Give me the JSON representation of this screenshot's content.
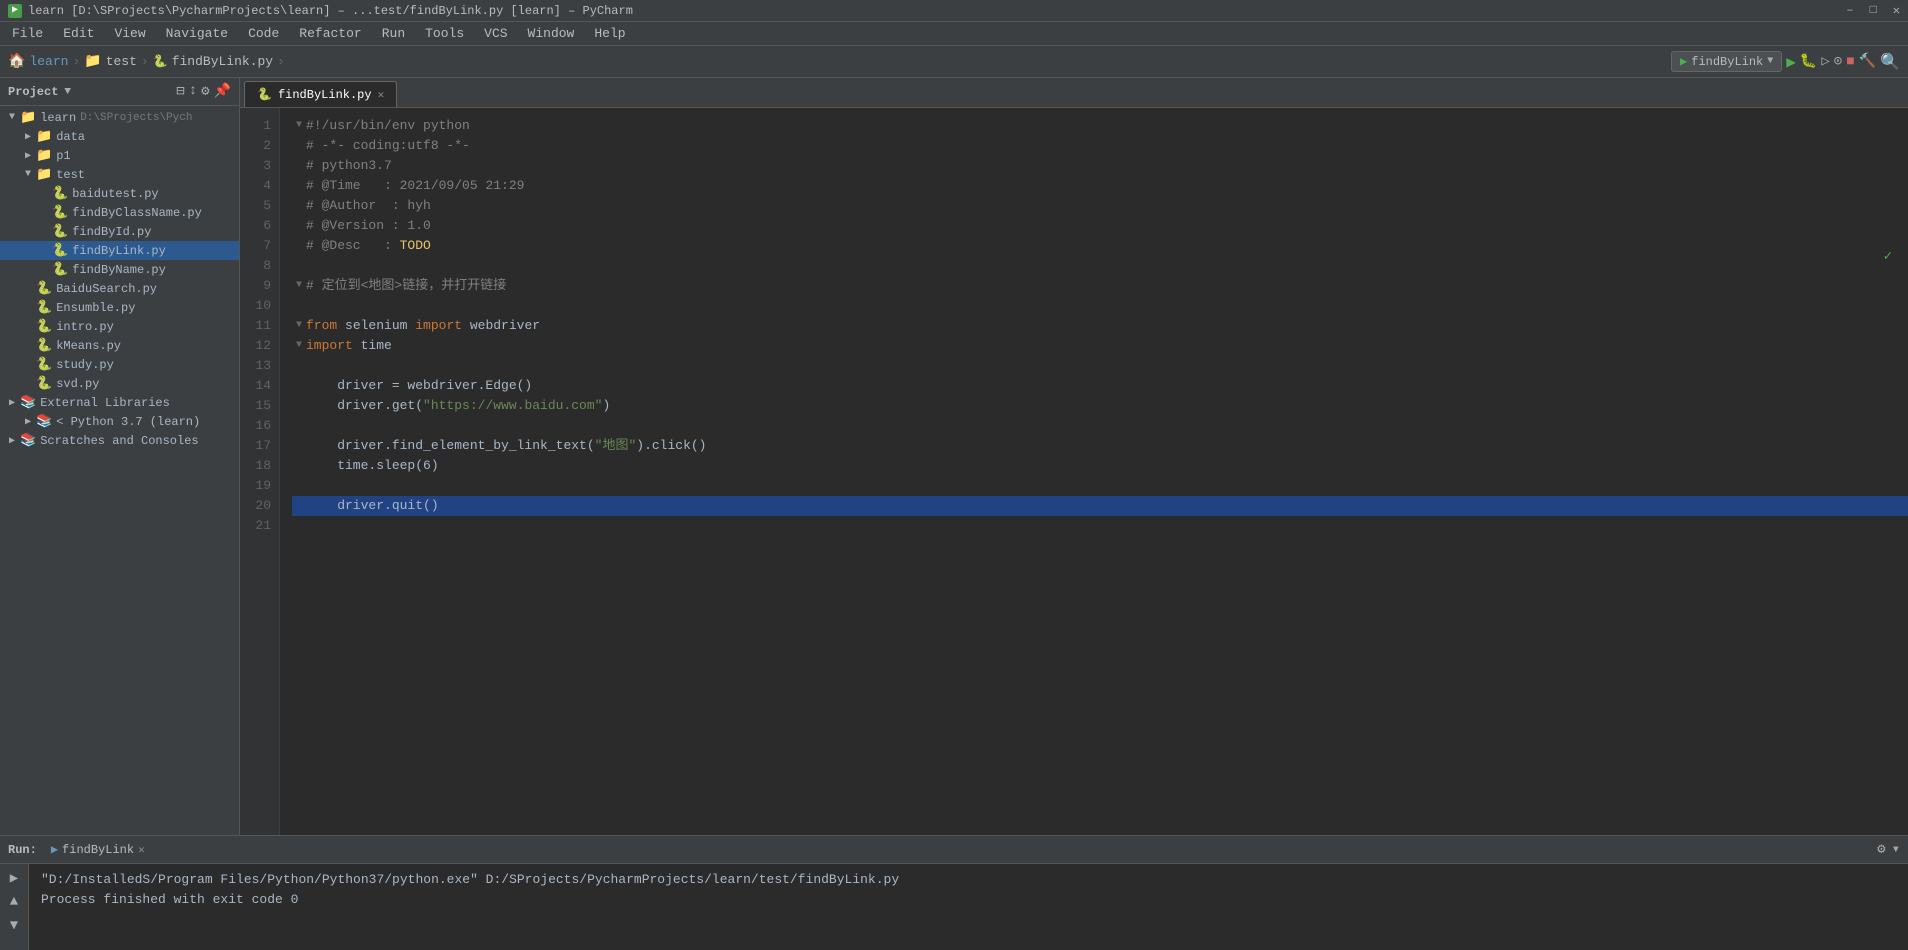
{
  "titleBar": {
    "text": "learn [D:\\SProjects\\PycharmProjects\\learn] – ...test/findByLink.py [learn] – PyCharm",
    "icon": "▶"
  },
  "menuBar": {
    "items": [
      "File",
      "Edit",
      "View",
      "Navigate",
      "Code",
      "Refactor",
      "Run",
      "Tools",
      "VCS",
      "Window",
      "Help"
    ]
  },
  "navBar": {
    "breadcrumbs": [
      "learn",
      "test",
      "findByLink.py"
    ],
    "runConfig": "findByLink"
  },
  "tabs": [
    {
      "label": "findByLink.py",
      "active": true,
      "modified": false
    }
  ],
  "sidebar": {
    "title": "Project",
    "tree": [
      {
        "level": 0,
        "type": "folder",
        "label": "learn",
        "path": "D:\\SProjects\\Pych",
        "open": true,
        "arrow": "▼"
      },
      {
        "level": 1,
        "type": "folder",
        "label": "data",
        "open": false,
        "arrow": "▶"
      },
      {
        "level": 1,
        "type": "folder",
        "label": "p1",
        "open": false,
        "arrow": "▶"
      },
      {
        "level": 1,
        "type": "folder",
        "label": "test",
        "open": true,
        "arrow": "▼"
      },
      {
        "level": 2,
        "type": "py",
        "label": "baidutest.py",
        "open": false,
        "arrow": ""
      },
      {
        "level": 2,
        "type": "py",
        "label": "findByClassName.py",
        "open": false,
        "arrow": ""
      },
      {
        "level": 2,
        "type": "py",
        "label": "findById.py",
        "open": false,
        "arrow": ""
      },
      {
        "level": 2,
        "type": "py",
        "label": "findByLink.py",
        "open": false,
        "arrow": "",
        "selected": true
      },
      {
        "level": 2,
        "type": "py",
        "label": "findByName.py",
        "open": false,
        "arrow": ""
      },
      {
        "level": 1,
        "type": "py",
        "label": "BaiduSearch.py",
        "open": false,
        "arrow": ""
      },
      {
        "level": 1,
        "type": "py",
        "label": "Ensumble.py",
        "open": false,
        "arrow": ""
      },
      {
        "level": 1,
        "type": "py",
        "label": "intro.py",
        "open": false,
        "arrow": ""
      },
      {
        "level": 1,
        "type": "py",
        "label": "kMeans.py",
        "open": false,
        "arrow": ""
      },
      {
        "level": 1,
        "type": "py",
        "label": "study.py",
        "open": false,
        "arrow": ""
      },
      {
        "level": 1,
        "type": "py",
        "label": "svd.py",
        "open": false,
        "arrow": ""
      },
      {
        "level": 0,
        "type": "extlib",
        "label": "External Libraries",
        "open": false,
        "arrow": "▶"
      },
      {
        "level": 1,
        "type": "extlib",
        "label": "< Python 3.7 (learn)",
        "open": false,
        "arrow": "▶"
      },
      {
        "level": 0,
        "type": "extlib",
        "label": "Scratches and Consoles",
        "open": false,
        "arrow": "▶"
      }
    ]
  },
  "editor": {
    "filename": "findByLink.py",
    "lines": [
      {
        "num": 1,
        "fold": "▼",
        "tokens": [
          {
            "cls": "c-shebang",
            "t": "#!/usr/bin/env python"
          }
        ]
      },
      {
        "num": 2,
        "fold": " ",
        "tokens": [
          {
            "cls": "c-comment",
            "t": "# -*- coding:utf8 -*-"
          }
        ]
      },
      {
        "num": 3,
        "fold": " ",
        "tokens": [
          {
            "cls": "c-comment",
            "t": "# python3.7"
          }
        ]
      },
      {
        "num": 4,
        "fold": " ",
        "tokens": [
          {
            "cls": "c-comment",
            "t": "# @Time   : 2021/09/05 21:29"
          }
        ]
      },
      {
        "num": 5,
        "fold": " ",
        "tokens": [
          {
            "cls": "c-comment",
            "t": "# @Author  : hyh"
          }
        ]
      },
      {
        "num": 6,
        "fold": " ",
        "tokens": [
          {
            "cls": "c-comment",
            "t": "# @Version : 1.0"
          }
        ]
      },
      {
        "num": 7,
        "fold": " ",
        "tokens": [
          {
            "cls": "c-comment",
            "t": "# @Desc   : "
          },
          {
            "cls": "c-todo",
            "t": "TODO"
          }
        ]
      },
      {
        "num": 8,
        "fold": " ",
        "tokens": []
      },
      {
        "num": 9,
        "fold": "▼",
        "tokens": [
          {
            "cls": "c-comment",
            "t": "# 定位到<地图>链接，并打开链接"
          }
        ]
      },
      {
        "num": 10,
        "fold": " ",
        "tokens": []
      },
      {
        "num": 11,
        "fold": "▼",
        "tokens": [
          {
            "cls": "c-keyword",
            "t": "from"
          },
          {
            "cls": "c-plain",
            "t": " selenium "
          },
          {
            "cls": "c-keyword",
            "t": "import"
          },
          {
            "cls": "c-plain",
            "t": " webdriver"
          }
        ]
      },
      {
        "num": 12,
        "fold": "▼",
        "tokens": [
          {
            "cls": "c-keyword",
            "t": "import"
          },
          {
            "cls": "c-plain",
            "t": " time"
          }
        ]
      },
      {
        "num": 13,
        "fold": " ",
        "tokens": []
      },
      {
        "num": 14,
        "fold": " ",
        "tokens": [
          {
            "cls": "c-plain",
            "t": "    driver = webdriver.Edge()"
          }
        ]
      },
      {
        "num": 15,
        "fold": " ",
        "tokens": [
          {
            "cls": "c-plain",
            "t": "    driver.get("
          },
          {
            "cls": "c-string",
            "t": "\"https://www.baidu.com\""
          },
          {
            "cls": "c-plain",
            "t": ")"
          }
        ]
      },
      {
        "num": 16,
        "fold": " ",
        "tokens": []
      },
      {
        "num": 17,
        "fold": " ",
        "tokens": [
          {
            "cls": "c-plain",
            "t": "    driver.find_element_by_link_text("
          },
          {
            "cls": "c-string",
            "t": "\"地图\""
          },
          {
            "cls": "c-plain",
            "t": ").click()"
          }
        ]
      },
      {
        "num": 18,
        "fold": " ",
        "tokens": [
          {
            "cls": "c-plain",
            "t": "    time.sleep(6)"
          }
        ]
      },
      {
        "num": 19,
        "fold": " ",
        "tokens": []
      },
      {
        "num": 20,
        "fold": " ",
        "tokens": [
          {
            "cls": "c-plain",
            "t": "    driver.quit()"
          }
        ],
        "highlighted": true
      },
      {
        "num": 21,
        "fold": " ",
        "tokens": []
      }
    ]
  },
  "bottomPanel": {
    "tabLabel": "findByLink",
    "outputLines": [
      "\"D:/InstalledS/Program Files/Python/Python37/python.exe\" D:/SProjects/PycharmProjects/learn/test/findByLink.py",
      "",
      "Process finished with exit code 0"
    ]
  }
}
